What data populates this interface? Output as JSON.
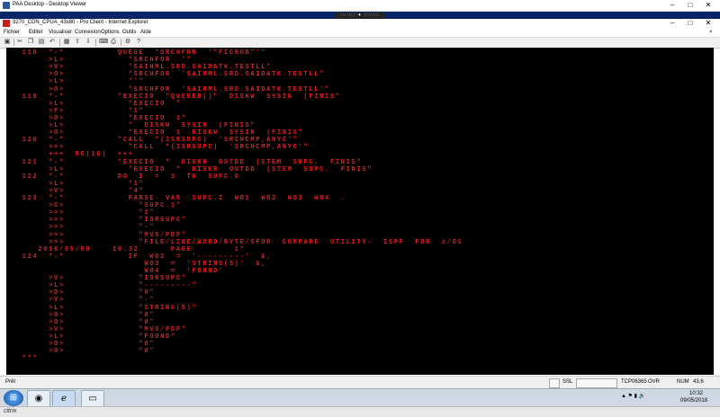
{
  "outer_window": {
    "title": "PAA Desktop - Desktop Viewer",
    "citrix_toolbar_label": "::::::: ✦ :::::::"
  },
  "inner_window": {
    "title": "3270_CDN_CPUA_43x80 - Pro Client - Internet Explorer"
  },
  "menu": [
    "Fichier",
    "Editer",
    "Visualiser",
    "Connexion",
    "Options",
    "Outils",
    "Aide"
  ],
  "toolbar_icons": [
    "session-icon",
    "cut-icon",
    "copy-icon",
    "paste-icon",
    "undo-icon",
    "macro-icon",
    "send-icon",
    "receive-icon",
    "keyboard-icon",
    "print-icon",
    "settings-icon",
    "help-icon"
  ],
  "terminal": {
    "text_color": "#e02020",
    "lines": [
      "   118  *-*          QUEUE  \"SRCHFOR  '\"FICBOB\"'\"",
      "        >L>            \"SRCHFOR  '\"",
      "        >V>            \"SAIHML.SRD.SAIDATK.TESTLL\"",
      "        >O>            \"SRCHFOR  'SAIHML.SRD.SAIDATK.TESTLL\"",
      "        >L>            \"'\"",
      "        >O>            \"SRCHFOR  'SAIHML.SRD.SAIDATK.TESTLL'\"",
      "   119  *-*          \"EXECIO  \"QUEUED()\"  DISKW  SYSIN  (FINIS\"",
      "        >L>            \"EXECIO  \"",
      "        >F>            \"1\"",
      "        >O>            \"EXECIO  1\"",
      "        >L>            \"  DISKW  SYSIN  (FINIS\"",
      "        >O>            \"EXECIO  1  DISKW  SYSIN  (FINIS\"",
      "   120  *-*          \"CALL  *(ISRSUPC)  'SRCHCMP,ANYC'\"",
      "        >>>            \"CALL  *(ISRSUPC)  'SRCHCMP,ANYC'\"",
      "        +++  RC(16)  +++",
      "   121  *-*          \"EXECIO  *  DISKR  OUTDD  (STEM  SUPC.  FINIS\"",
      "        >L>            \"EXECIO  *  DISKR  OUTDD  (STEM  SUPC.  FINIS\"",
      "   122  *-*          DO  I  =  1  TO  SUPC.0",
      "        >L>            \"1\"",
      "        >V>            \"4\"",
      "   123  *-*            PARSE  VAR  SUPC.I  WO1  WO2  WO3  WO4  .",
      "        >C>              \"SUPC.1\"",
      "        >>>              \"1\"",
      "        >>>              \"ISRSUPC\"",
      "        >>>              \"-\"",
      "        >>>              \"MVS/PDF\"",
      "        >>>              \"FILE/LINE/WORD/BYTE/SFOR  COMPARE  UTILITY-  ISPF  FOR  z/OS",
      "      2018/05/09    10.32      PAGE        1\"",
      "   124  *-*            IF  WO2  =  '---------'  &,",
      "                          WO3  =  'STRING(S)'  &,",
      "                          WO4  =  'FOUND'",
      "        >V>              \"ISRSUPC\"",
      "        >L>              \"---------\"",
      "        >O>              \"0\"",
      "        >V>              \"-\"",
      "        >L>              \"STRING(S)\"",
      "        >O>              \"0\"",
      "        >O>              \"0\"",
      "        >V>              \"MVS/PDF\"",
      "        >L>              \"FOUND\"",
      "        >O>              \"0\"",
      "        >O>              \"0\"",
      "   ***"
    ]
  },
  "status_bar": {
    "left": "Prêt",
    "ssl": "SSL",
    "lock": "🔒",
    "host": "TCP06365",
    "ovr": "OVR",
    "num": "NUM",
    "cursor": "43,6"
  },
  "taskbar": {
    "time": "10:32",
    "date": "09/05/2018"
  },
  "citrix": {
    "brand": "citrix"
  }
}
